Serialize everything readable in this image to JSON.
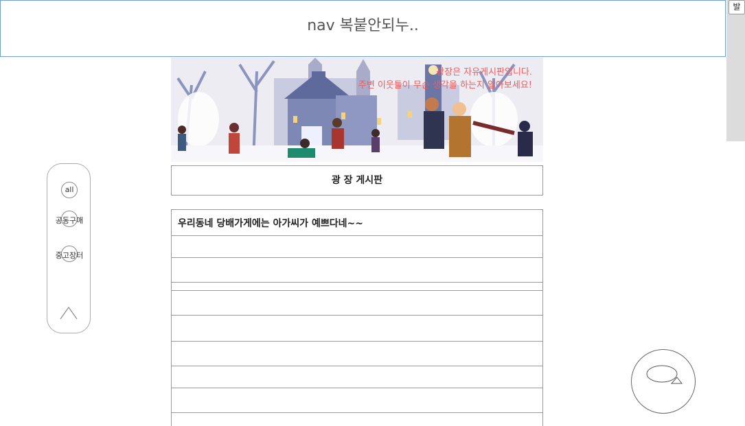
{
  "nav": {
    "title": "nav 복붙안되누.."
  },
  "side_button": {
    "label": "발"
  },
  "banner": {
    "line1": "광장은 자유게시판입니다.",
    "line2": "주변 이웃들이 무슨 생각을 하는지 알아보세요!"
  },
  "board": {
    "title": "광 장 게시판"
  },
  "posts": [
    "우리동네 당배가게에는 아가씨가 예쁘다네~~",
    "",
    "",
    "",
    "",
    "",
    "",
    "",
    ""
  ],
  "side_menu": {
    "items": [
      {
        "label": "all"
      },
      {
        "label": "공동구매"
      },
      {
        "label": "중고장터"
      }
    ],
    "up_icon": "up-arrow-icon"
  },
  "chat": {
    "icon": "chat-bubble-icon"
  }
}
